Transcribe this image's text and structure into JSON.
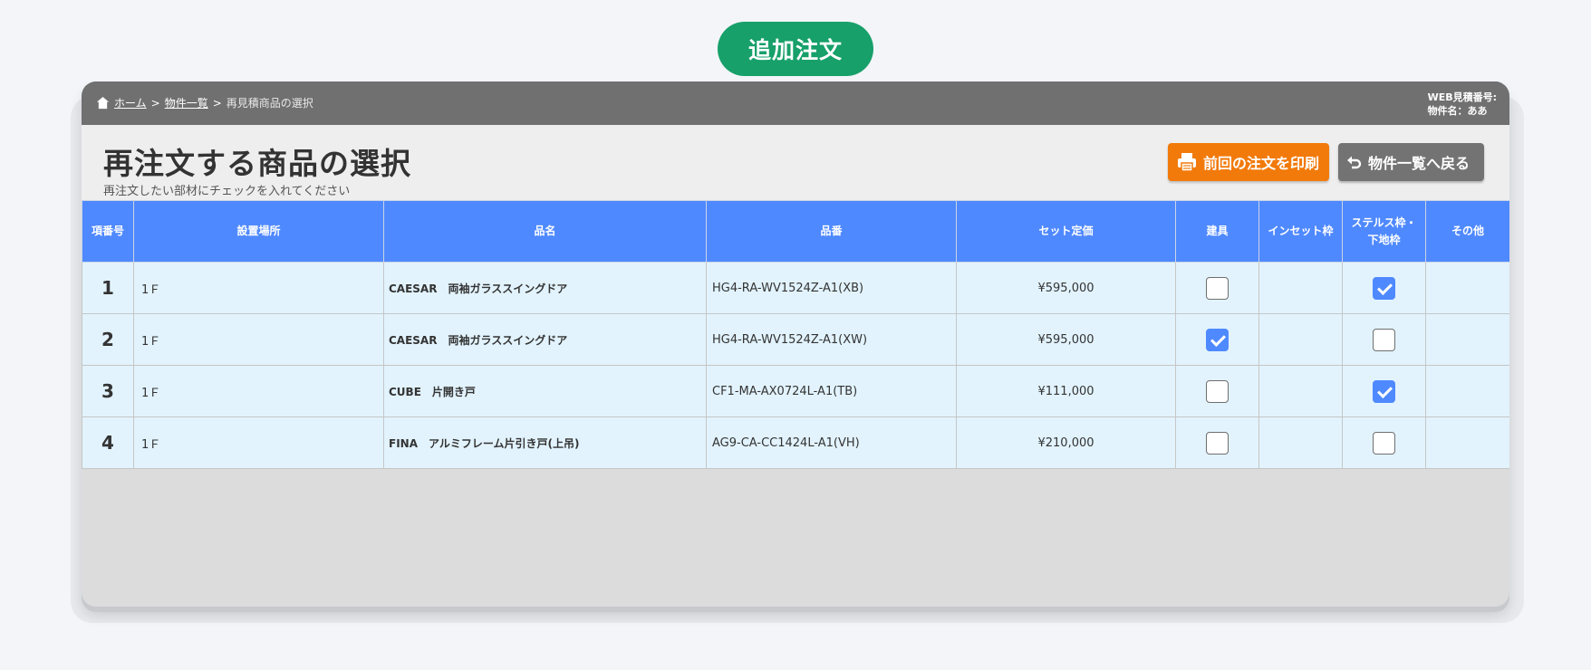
{
  "badge": "追加注文",
  "breadcrumb": {
    "home": "ホーム",
    "sep": ">",
    "list": "物件一覧",
    "current": "再見積商品の選択"
  },
  "web_info": {
    "estimate_no": "WEB見積番号:",
    "property_name": "物件名：ああ"
  },
  "page": {
    "title": "再注文する商品の選択",
    "subtitle": "再注文したい部材にチェックを入れてください"
  },
  "buttons": {
    "print": "前回の注文を印刷",
    "back": "物件一覧へ戻る"
  },
  "table": {
    "headers": {
      "no": "項番号",
      "place": "設置場所",
      "name": "品名",
      "code": "品番",
      "price": "セット定価",
      "door": "建具",
      "inset": "インセット枠",
      "stealth_1": "ステルス枠・",
      "stealth_2": "下地枠",
      "other": "その他"
    },
    "rows": [
      {
        "no": "1",
        "place": "1Ｆ",
        "name": "CAESAR　両袖ガラススイングドア",
        "code": "HG4-RA-WV1524Z-A1(XB)",
        "price": "¥595,000",
        "door": false,
        "stealth": true
      },
      {
        "no": "2",
        "place": "1Ｆ",
        "name": "CAESAR　両袖ガラススイングドア",
        "code": "HG4-RA-WV1524Z-A1(XW)",
        "price": "¥595,000",
        "door": true,
        "stealth": false
      },
      {
        "no": "3",
        "place": "1Ｆ",
        "name": "CUBE　片開き戸",
        "code": "CF1-MA-AX0724L-A1(TB)",
        "price": "¥111,000",
        "door": false,
        "stealth": true
      },
      {
        "no": "4",
        "place": "1Ｆ",
        "name": "FINA　アルミフレーム片引き戸(上吊)",
        "code": "AG9-CA-CC1424L-A1(VH)",
        "price": "¥210,000",
        "door": false,
        "stealth": false
      }
    ]
  },
  "colors": {
    "badge": "#17a06a",
    "header_blue": "#4f89ff",
    "print_orange": "#f27a0a",
    "topbar_gray": "#707070",
    "row_bg": "#e2f3fd"
  }
}
